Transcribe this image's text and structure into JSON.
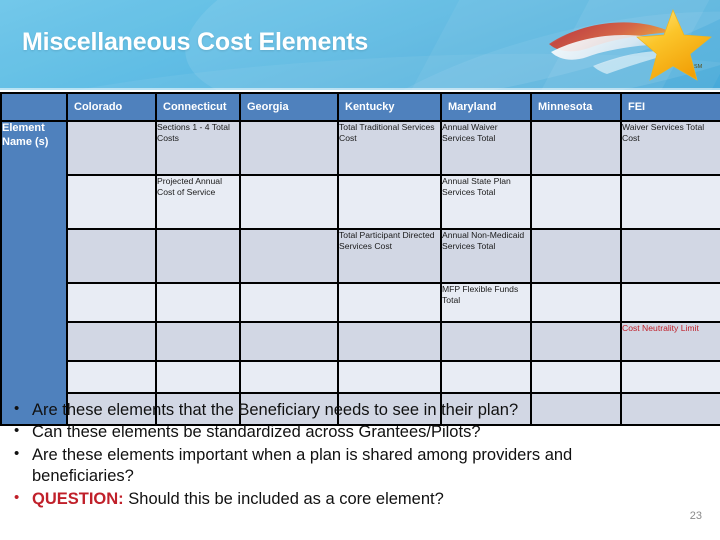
{
  "slide": {
    "title": "Miscellaneous Cost Elements",
    "number": "23",
    "logo_name": "star-swoosh-logo",
    "logo_trademark": "SM"
  },
  "table": {
    "row_header_label": "Element Name (s)",
    "columns": [
      "Colorado",
      "Connecticut",
      "Georgia",
      "Kentucky",
      "Maryland",
      "Minnesota",
      "FEI"
    ],
    "rows": [
      {
        "cells": [
          "",
          "Sections 1 -  4 Total Costs",
          "",
          "Total Traditional Services Cost",
          "Annual Waiver Services Total",
          "",
          "Waiver Services Total Cost"
        ],
        "red": [
          false,
          false,
          false,
          false,
          false,
          false,
          false
        ]
      },
      {
        "cells": [
          "",
          "Projected Annual Cost of Service",
          "",
          "",
          "Annual State Plan Services Total",
          "",
          ""
        ],
        "red": [
          false,
          false,
          false,
          false,
          false,
          false,
          false
        ]
      },
      {
        "cells": [
          "",
          "",
          "",
          "Total Participant Directed Services Cost",
          "Annual Non-Medicaid Services Total",
          "",
          ""
        ],
        "red": [
          false,
          false,
          false,
          false,
          false,
          false,
          false
        ]
      },
      {
        "cells": [
          "",
          "",
          "",
          "",
          "MFP Flexible Funds Total",
          "",
          ""
        ],
        "red": [
          false,
          false,
          false,
          false,
          false,
          false,
          false
        ]
      },
      {
        "cells": [
          "",
          "",
          "",
          "",
          "",
          "",
          "Cost Neutrality Limit"
        ],
        "red": [
          false,
          false,
          false,
          false,
          false,
          false,
          true
        ]
      },
      {
        "cells": [
          "",
          "",
          "",
          "",
          "",
          "",
          ""
        ],
        "red": [
          false,
          false,
          false,
          false,
          false,
          false,
          false
        ]
      },
      {
        "cells": [
          "",
          "",
          "",
          "",
          "",
          "",
          ""
        ],
        "red": [
          false,
          false,
          false,
          false,
          false,
          false,
          false
        ]
      }
    ]
  },
  "bullets": [
    {
      "text": "Are these elements that the Beneficiary needs to see in their plan?",
      "label": "",
      "question": false
    },
    {
      "text": "Can these elements be standardized across Grantees/Pilots?",
      "label": "",
      "question": false
    },
    {
      "text": "Are these elements important when a plan is shared among providers and beneficiaries?",
      "label": "",
      "question": false
    },
    {
      "text": " Should this be included as a core element?",
      "label": "QUESTION:",
      "question": true
    }
  ],
  "colors": {
    "header_blue": "#4f81bd",
    "banner_blue": "#4fb6e2",
    "row_dark": "#d2d7e4",
    "row_light": "#e8ecf4",
    "accent_red": "#c0202a",
    "logo_gold": "#f5c222"
  }
}
